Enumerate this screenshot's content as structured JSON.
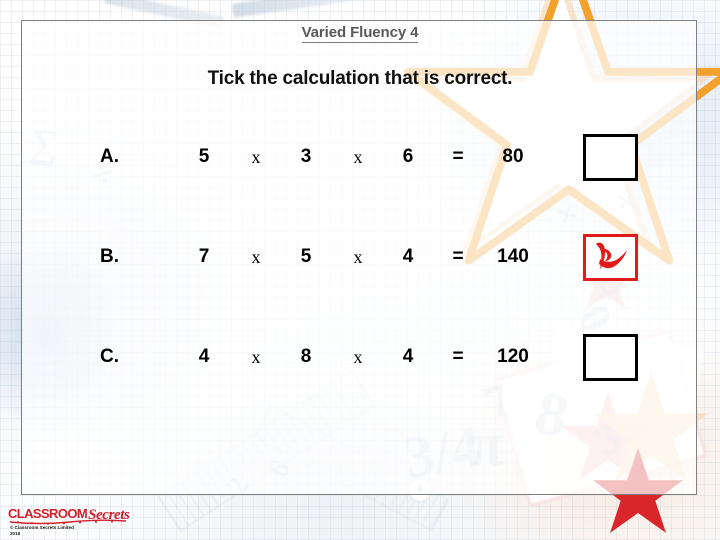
{
  "slide": {
    "title": "Varied Fluency 4",
    "instruction": "Tick the calculation that is correct."
  },
  "colors": {
    "title_gray": "#595959",
    "panel_border": "#7f7f7f",
    "box_black": "#000000",
    "tick_red": "#e01b1b",
    "logo_red": "#d4202a",
    "star_orange": "#f2a22c",
    "star_red": "#d8262a"
  },
  "questions": [
    {
      "label": "A.",
      "n1": "5",
      "op1": "x",
      "n2": "3",
      "op2": "x",
      "n3": "6",
      "eq": "=",
      "result": "80",
      "box_state": "empty",
      "box_name": "answer-box-a"
    },
    {
      "label": "B.",
      "n1": "7",
      "op1": "x",
      "n2": "5",
      "op2": "x",
      "n3": "4",
      "eq": "=",
      "result": "140",
      "box_state": "ticked",
      "box_name": "answer-box-b"
    },
    {
      "label": "C.",
      "n1": "4",
      "op1": "x",
      "n2": "8",
      "op2": "x",
      "n3": "4",
      "eq": "=",
      "result": "120",
      "box_state": "empty",
      "box_name": "answer-box-c"
    }
  ],
  "footer": {
    "logo_word": "CLASSROOM",
    "logo_script": "Secrets",
    "copyright": "© Classroom Secrets Limited\n2018"
  },
  "background": {
    "ghost_glyphs": [
      "3/4",
      "π",
      "8",
      "7",
      "4",
      "0",
      "3",
      "6",
      "2",
      "+",
      "×",
      "÷",
      "∑"
    ]
  }
}
